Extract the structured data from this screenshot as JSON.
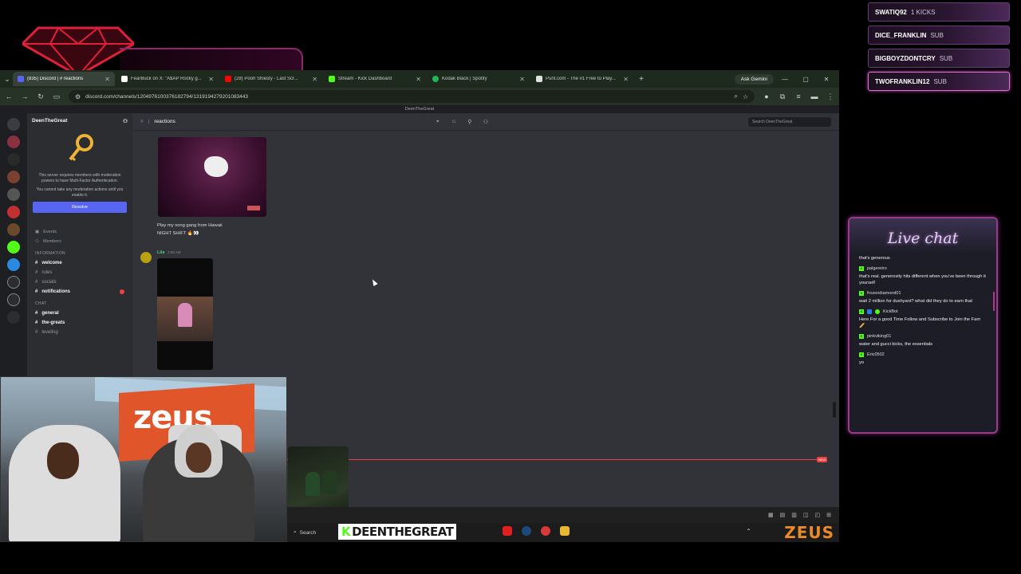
{
  "events": [
    {
      "user": "SWATIQ92",
      "type": "1 KICKS"
    },
    {
      "user": "DICE_FRANKLIN",
      "type": "SUB"
    },
    {
      "user": "BIGBOYZDONTCRY",
      "type": "SUB"
    },
    {
      "user": "TWOFRANKLIN12",
      "type": "SUB"
    }
  ],
  "browser": {
    "tabs": [
      {
        "title": "(835) Discord | # reactions",
        "active": true,
        "color": "#5865f2"
      },
      {
        "title": "FearBuck on X: \"A$AP Rocky g...",
        "active": false,
        "color": "#ffffff"
      },
      {
        "title": "(28) Pooh Shiesty - Last Scr...",
        "active": false,
        "color": "#ff0000"
      },
      {
        "title": "Stream - Kick Dashboard",
        "active": false,
        "color": "#53fc18"
      },
      {
        "title": "Kodak Black | Spotify",
        "active": false,
        "color": "#1db954"
      },
      {
        "title": "Punt.com - The #1 Free to Play...",
        "active": false,
        "color": "#e0e0e0"
      }
    ],
    "ask_gemini": "Ask Gemini",
    "url": "discord.com/channels/1204976100376182794/1319194279201083443"
  },
  "discord": {
    "window_title": "DeenTheGreat",
    "server_name": "DeenTheGreat",
    "mfa_text": "This server requires members with moderation powers to have Multi-Factor Authentication.",
    "mfa_sub": "You cannot take any moderation actions until you enable it.",
    "resolve_label": "Resolve",
    "nav": [
      "Events",
      "Members"
    ],
    "category_info": "INFORMATION",
    "info_channels": [
      "welcome",
      "rules",
      "socials",
      "notifications"
    ],
    "category_chat": "CHAT",
    "chat_channels": [
      "general",
      "the-greats",
      "leveling"
    ],
    "channel": "reactions",
    "search_placeholder": "Search DeenTheGreat",
    "msg1_line1": "Play my song gang from Hawaii",
    "msg1_line2": "NIGHT SHIFT 🔥👀",
    "author2": "Lila",
    "time2": "2:38 AM",
    "new_label": "NEW"
  },
  "taskbar": {
    "search": "Search",
    "streamer": "DEENTHEGREAT",
    "streamer_k": "K",
    "sponsor": "ZEUS"
  },
  "webcam": {
    "sign_text": "zeus"
  },
  "livechat": {
    "title": "Live chat",
    "first_msg": "that's generous",
    "messages": [
      {
        "user": "palgeretro",
        "text": "that's real. generosity hits different when you've been through it yourself",
        "extra": false
      },
      {
        "user": "frozendiamond01",
        "text": "wait 2 million for dushyant? what did they do to earn that",
        "extra": false
      },
      {
        "user": "KickBot",
        "text": "Here For a good Time Follow and Subscribe to Join the Fam 🥖",
        "extra": true
      },
      {
        "user": "pinkviking01",
        "text": "water and gucci kicks, the essentials",
        "extra": false
      },
      {
        "user": "Eric0502",
        "text": "yo",
        "extra": false
      }
    ]
  },
  "colors": {
    "accent": "#5865f2",
    "kick": "#53fc18",
    "chat_border": "#9a3a8a"
  }
}
